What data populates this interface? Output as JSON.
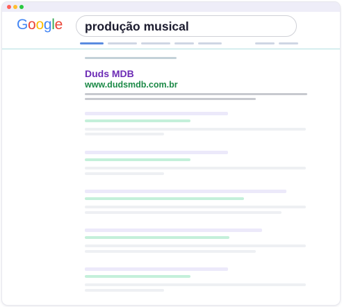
{
  "window": {
    "buttons": [
      {
        "name": "close",
        "color": "#ff6058"
      },
      {
        "name": "minimize",
        "color": "#ffbd2e"
      },
      {
        "name": "maximize",
        "color": "#28c940"
      }
    ]
  },
  "logo": {
    "letters": [
      {
        "char": "G",
        "color": "#4285f4"
      },
      {
        "char": "o",
        "color": "#ea4335"
      },
      {
        "char": "o",
        "color": "#fbbc05"
      },
      {
        "char": "g",
        "color": "#4285f4"
      },
      {
        "char": "l",
        "color": "#34a853"
      },
      {
        "char": "e",
        "color": "#ea4335"
      }
    ]
  },
  "search": {
    "query": "produção musical"
  },
  "results": {
    "featured": {
      "title": "Duds MDB",
      "url": "www.dudsmdb.com.br"
    }
  },
  "colors": {
    "title_link": "#6c2bb5",
    "url_green": "#1c8a47",
    "active_tab": "#5a8be0"
  }
}
